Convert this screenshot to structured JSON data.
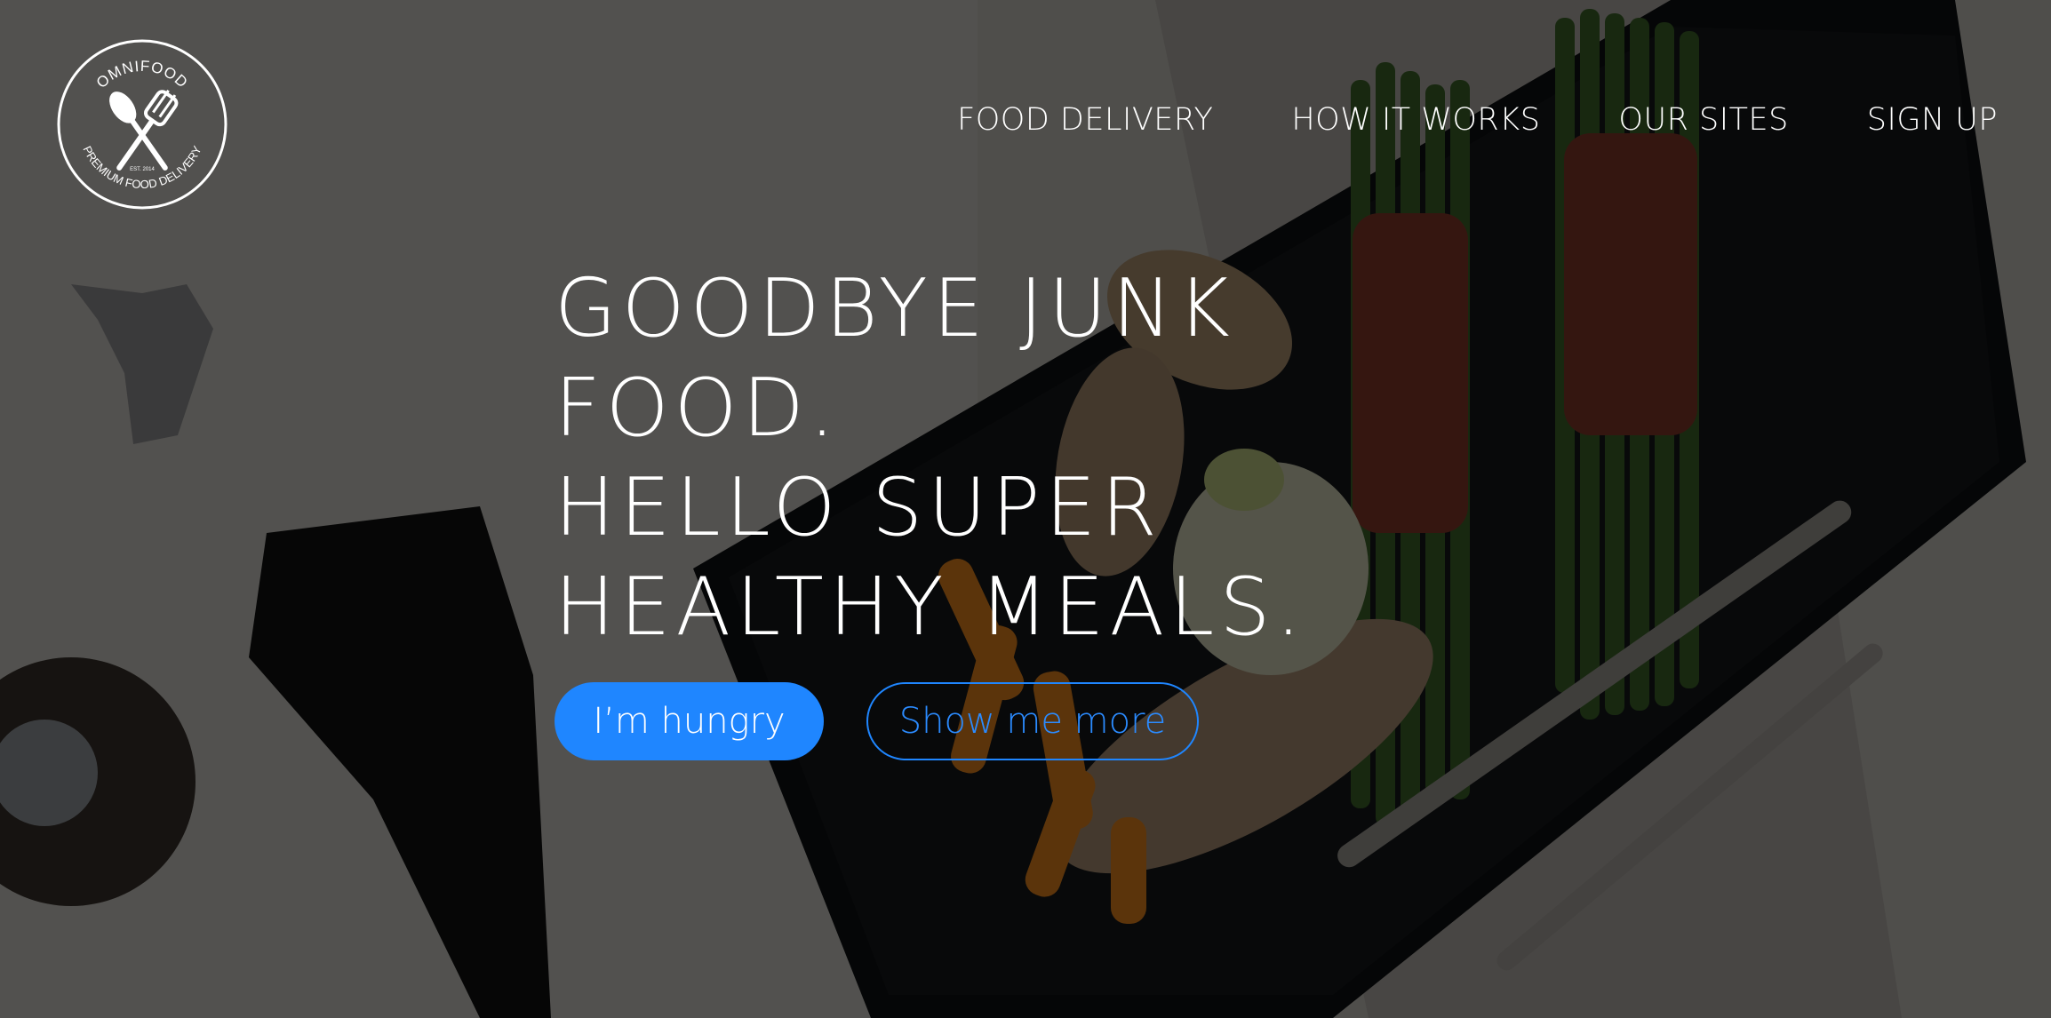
{
  "logo": {
    "brand": "OMNIFOOD",
    "tagline": "PREMIUM FOOD DELIVERY",
    "established": "EST. 2014",
    "icon": "crossed-spoon-fork-icon"
  },
  "nav": {
    "items": [
      {
        "label": "FOOD DELIVERY"
      },
      {
        "label": "HOW IT WORKS"
      },
      {
        "label": "OUR SITES"
      },
      {
        "label": "SIGN UP"
      }
    ]
  },
  "hero": {
    "lines": [
      "GOODBYE JUNK",
      "FOOD.",
      "HELLO SUPER",
      "HEALTHY MEALS."
    ],
    "primary_button": "I’m hungry",
    "secondary_button": "Show me more"
  },
  "colors": {
    "accent": "#1f86ff",
    "text": "#ffffff",
    "overlay": "rgba(0,0,0,0.62)"
  }
}
